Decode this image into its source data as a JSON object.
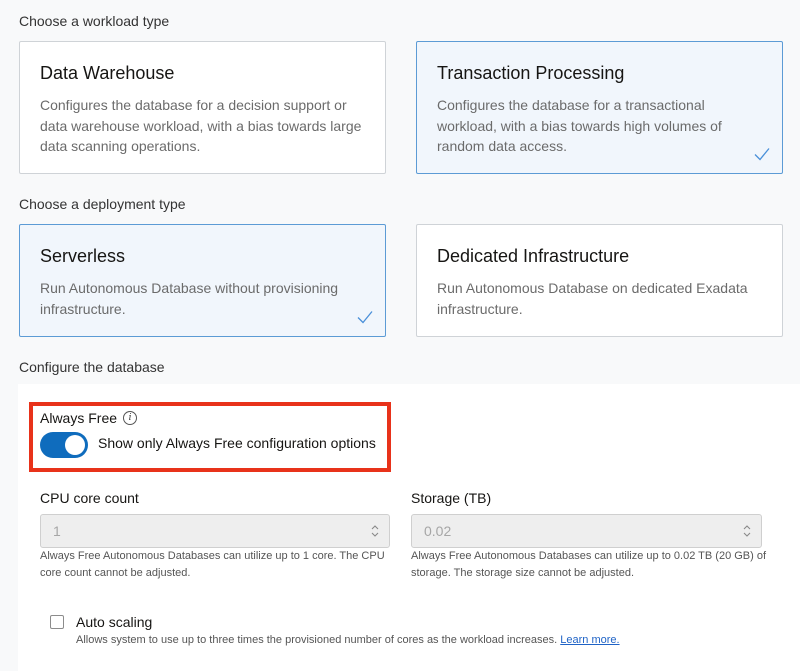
{
  "workload": {
    "heading": "Choose a workload type",
    "cards": [
      {
        "title": "Data Warehouse",
        "description": "Configures the database for a decision support or data warehouse workload, with a bias towards large data scanning operations.",
        "selected": false
      },
      {
        "title": "Transaction Processing",
        "description": "Configures the database for a transactional workload, with a bias towards high volumes of random data access.",
        "selected": true
      }
    ]
  },
  "deployment": {
    "heading": "Choose a deployment type",
    "cards": [
      {
        "title": "Serverless",
        "description": "Run Autonomous Database without provisioning infrastructure.",
        "selected": true
      },
      {
        "title": "Dedicated Infrastructure",
        "description": "Run Autonomous Database on dedicated Exadata infrastructure.",
        "selected": false
      }
    ]
  },
  "configure": {
    "heading": "Configure the database",
    "always_free": {
      "label": "Always Free",
      "info_icon": "info-icon",
      "toggle_on": true,
      "toggle_label": "Show only Always Free configuration options"
    },
    "cpu": {
      "label": "CPU core count",
      "value": "1",
      "help": "Always Free Autonomous Databases can utilize up to 1 core. The CPU core count cannot be adjusted."
    },
    "storage": {
      "label": "Storage (TB)",
      "value": "0.02",
      "help": "Always Free Autonomous Databases can utilize up to 0.02 TB (20 GB) of storage. The storage size cannot be adjusted."
    },
    "auto_scaling": {
      "label": "Auto scaling",
      "checked": false,
      "help": "Allows system to use up to three times the provisioned number of cores as the workload increases.",
      "link": "Learn more."
    }
  },
  "colors": {
    "accent": "#0f6cbd",
    "selected_border": "#5c9bd5",
    "highlight_box": "#e8321a",
    "link": "#1f63c6"
  }
}
